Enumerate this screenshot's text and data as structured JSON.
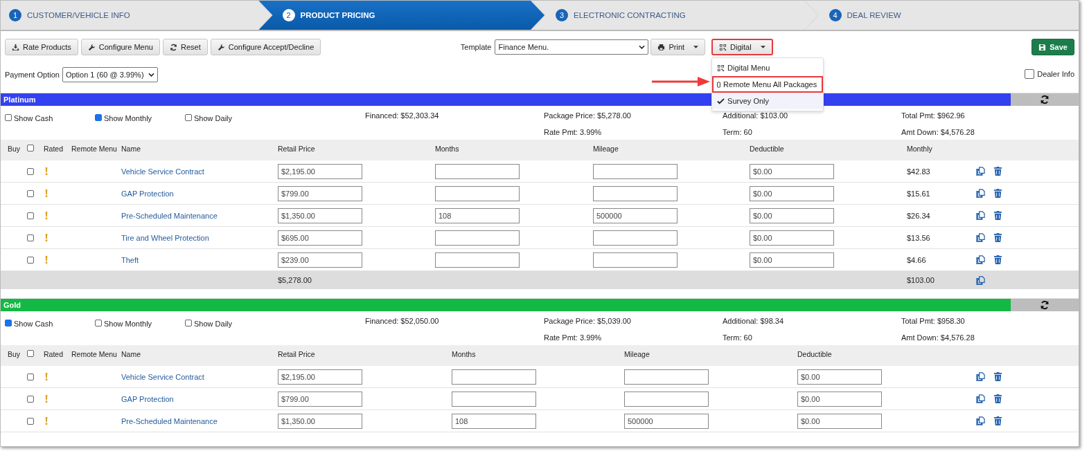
{
  "steps": [
    {
      "number": "1",
      "label": "CUSTOMER/VEHICLE INFO",
      "selected": false
    },
    {
      "number": "2",
      "label": "PRODUCT PRICING",
      "selected": true
    },
    {
      "number": "3",
      "label": "ELECTRONIC CONTRACTING",
      "selected": false
    },
    {
      "number": "4",
      "label": "DEAL REVIEW",
      "selected": false
    }
  ],
  "toolbar": [
    {
      "label": "Rate Products",
      "kind": "download"
    },
    {
      "label": "Configure Menu",
      "kind": "wrench"
    },
    {
      "label": "Reset",
      "kind": "refresh"
    },
    {
      "label": "Configure Accept/Decline",
      "kind": "wrench"
    }
  ],
  "template": {
    "label": "Template",
    "value": "Finance Menu."
  },
  "print_button": {
    "label": "Print"
  },
  "digital_button": {
    "label": "Digital",
    "highlighted": true
  },
  "digital_menu": [
    {
      "label": "Digital Menu",
      "kind": "qr",
      "checked": false,
      "highlighted": false
    },
    {
      "label": "Remote Menu All Packages",
      "kind": "phone",
      "checked": false,
      "highlighted": true
    },
    {
      "label": "Survey Only",
      "kind": "none",
      "checked": true,
      "highlighted": false
    }
  ],
  "save_button": {
    "label": "Save"
  },
  "payment_option": {
    "label": "Payment Option",
    "value": "Option 1 (60 @ 3.99%)"
  },
  "dealer_info": {
    "label": "Dealer Info",
    "checked": false
  },
  "packages": [
    {
      "name": "Platinum",
      "color": "#3341f0",
      "select_all": false,
      "options": [
        {
          "label": "Show Cash",
          "checked": false
        },
        {
          "label": "Show Monthly",
          "checked": true
        },
        {
          "label": "Show Daily",
          "checked": false
        }
      ],
      "summary": [
        {
          "lines": [
            "Financed: $52,303.34"
          ]
        },
        {
          "lines": [
            "Package Price: $5,278.00",
            "Rate Pmt: 3.99%"
          ]
        },
        {
          "lines": [
            "Additional: $103.00",
            "Term: 60"
          ]
        },
        {
          "lines": [
            "Total Pmt: $962.96",
            "Amt Down: $4,576.28"
          ]
        }
      ],
      "columns": [
        "Buy",
        "Rated",
        "Remote Menu",
        "Name",
        "Retail Price",
        "Months",
        "Mileage",
        "Deductible",
        "Monthly"
      ],
      "rows": [
        {
          "buy": false,
          "name": "Vehicle Service Contract",
          "retail": "$2,195.00",
          "months": "",
          "mileage": "",
          "deductible": "$0.00",
          "monthly": "$42.83"
        },
        {
          "buy": false,
          "name": "GAP Protection",
          "retail": "$799.00",
          "months": "",
          "mileage": "",
          "deductible": "$0.00",
          "monthly": "$15.61"
        },
        {
          "buy": false,
          "name": "Pre-Scheduled Maintenance",
          "retail": "$1,350.00",
          "months": "108",
          "mileage": "500000",
          "deductible": "$0.00",
          "monthly": "$26.34"
        },
        {
          "buy": false,
          "name": "Tire and Wheel Protection",
          "retail": "$695.00",
          "months": "",
          "mileage": "",
          "deductible": "$0.00",
          "monthly": "$13.56"
        },
        {
          "buy": false,
          "name": "Theft",
          "retail": "$239.00",
          "months": "",
          "mileage": "",
          "deductible": "$0.00",
          "monthly": "$4.66"
        }
      ],
      "totals": {
        "retail": "$5,278.00",
        "monthly": "$103.00"
      }
    },
    {
      "name": "Gold",
      "color": "#14b844",
      "select_all": false,
      "options": [
        {
          "label": "Show Cash",
          "checked": true
        },
        {
          "label": "Show Monthly",
          "checked": false
        },
        {
          "label": "Show Daily",
          "checked": false
        }
      ],
      "summary": [
        {
          "lines": [
            "Financed: $52,050.00"
          ]
        },
        {
          "lines": [
            "Package Price: $5,039.00",
            "Rate Pmt: 3.99%"
          ]
        },
        {
          "lines": [
            "Additional: $98.34",
            "Term: 60"
          ]
        },
        {
          "lines": [
            "Total Pmt: $958.30",
            "Amt Down: $4,576.28"
          ]
        }
      ],
      "columns": [
        "Buy",
        "Rated",
        "Remote Menu",
        "Name",
        "Retail Price",
        "Months",
        "Mileage",
        "Deductible"
      ],
      "rows": [
        {
          "buy": false,
          "name": "Vehicle Service Contract",
          "retail": "$2,195.00",
          "months": "",
          "mileage": "",
          "deductible": "$0.00"
        },
        {
          "buy": false,
          "name": "GAP Protection",
          "retail": "$799.00",
          "months": "",
          "mileage": "",
          "deductible": "$0.00"
        },
        {
          "buy": false,
          "name": "Pre-Scheduled Maintenance",
          "retail": "$1,350.00",
          "months": "108",
          "mileage": "500000",
          "deductible": "$0.00"
        }
      ]
    }
  ]
}
